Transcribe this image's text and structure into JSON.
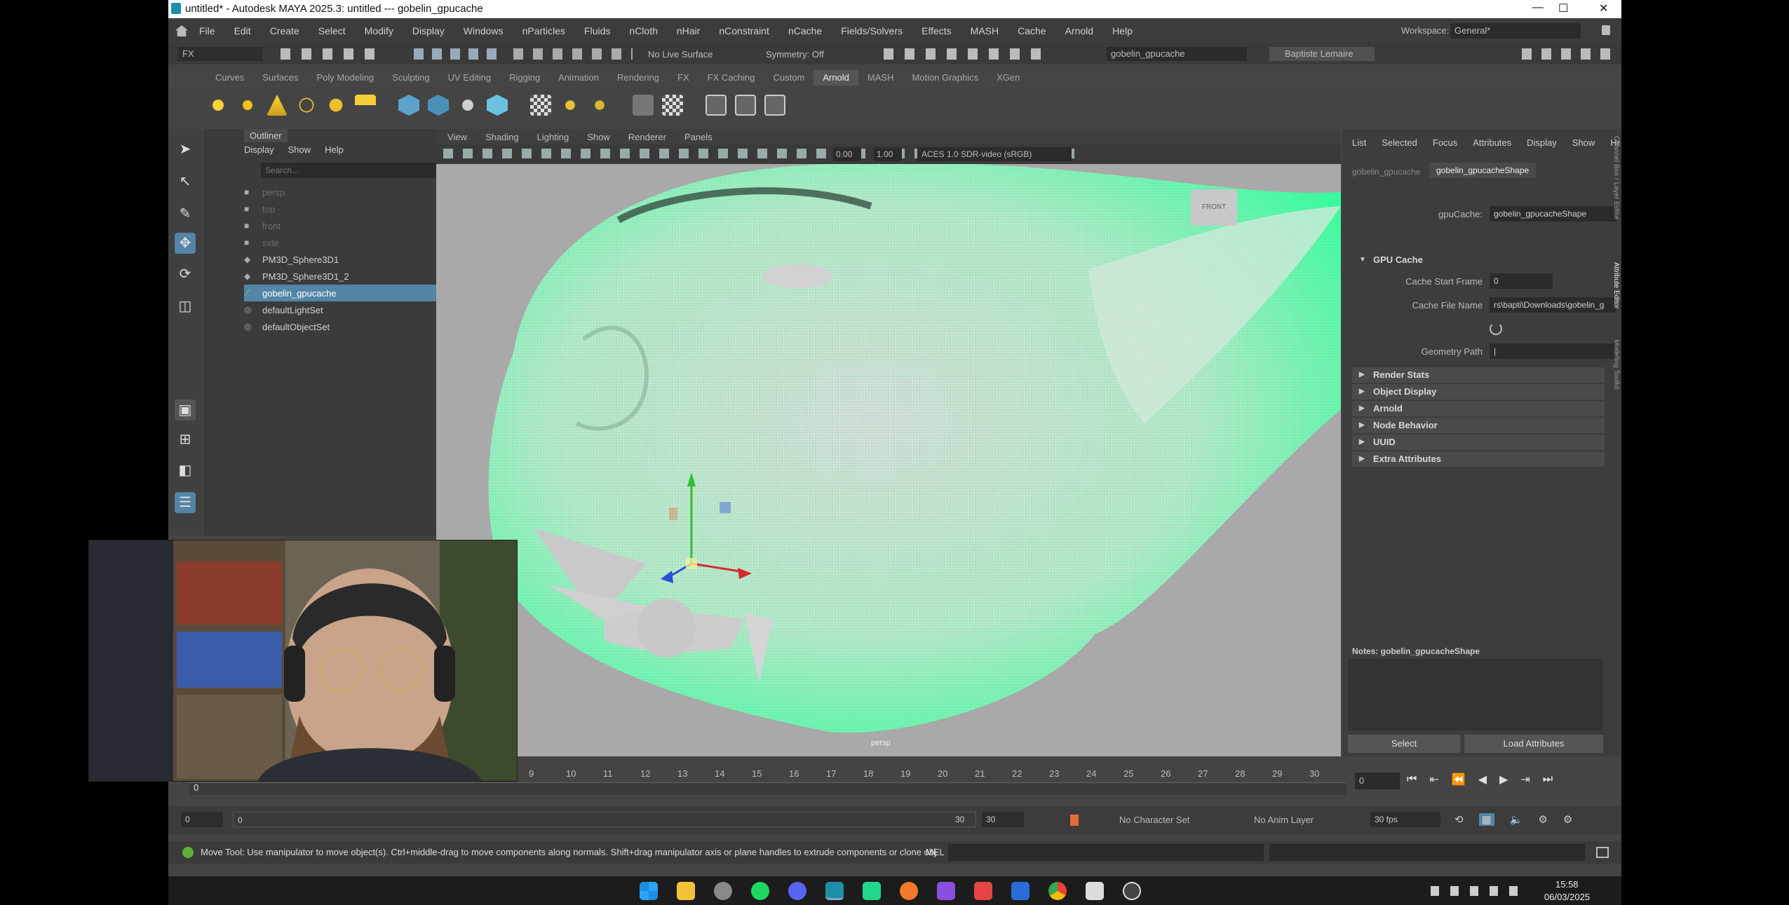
{
  "window": {
    "title": "untitled* - Autodesk MAYA 2025.3: untitled  ---  gobelin_gpucache",
    "controls": [
      "—",
      "☐",
      "✕"
    ]
  },
  "menubar": {
    "items": [
      "File",
      "Edit",
      "Create",
      "Select",
      "Modify",
      "Display",
      "Windows",
      "nParticles",
      "Fluids",
      "nCloth",
      "nHair",
      "nConstraint",
      "nCache",
      "Fields/Solvers",
      "Effects",
      "MASH",
      "Cache",
      "Arnold",
      "Help"
    ],
    "workspace_label": "Workspace:",
    "workspace_value": "General*"
  },
  "statusline": {
    "mode": "FX",
    "live_surface": "No Live Surface",
    "symmetry": "Symmetry: Off",
    "search_value": "gobelin_gpucache",
    "user": "Baptiste Lemaire"
  },
  "shelf": {
    "tabs": [
      "Curves",
      "Surfaces",
      "Poly Modeling",
      "Sculpting",
      "UV Editing",
      "Rigging",
      "Animation",
      "Rendering",
      "FX",
      "FX Caching",
      "Custom",
      "Arnold",
      "MASH",
      "Motion Graphics",
      "XGen"
    ],
    "active_tab": "Arnold"
  },
  "outliner": {
    "title": "Outliner",
    "menu": [
      "Display",
      "Show",
      "Help"
    ],
    "search_placeholder": "Search...",
    "items": [
      {
        "label": "persp",
        "icon": "camera-icon",
        "dim": true
      },
      {
        "label": "top",
        "icon": "camera-icon",
        "dim": true
      },
      {
        "label": "front",
        "icon": "camera-icon",
        "dim": true
      },
      {
        "label": "side",
        "icon": "camera-icon",
        "dim": true
      },
      {
        "label": "PM3D_Sphere3D1",
        "icon": "transform-icon",
        "dim": false
      },
      {
        "label": "PM3D_Sphere3D1_2",
        "icon": "transform-icon",
        "dim": false
      },
      {
        "label": "gobelin_gpucache",
        "icon": "gpucache-icon",
        "dim": false,
        "selected": true
      },
      {
        "label": "defaultLightSet",
        "icon": "set-icon",
        "dim": false
      },
      {
        "label": "defaultObjectSet",
        "icon": "set-icon",
        "dim": false
      }
    ]
  },
  "viewport": {
    "menu": [
      "View",
      "Shading",
      "Lighting",
      "Show",
      "Renderer",
      "Panels"
    ],
    "exposure": "0.00",
    "gamma": "1.00",
    "color_space": "ACES 1.0 SDR-video (sRGB)",
    "camera_label": "persp",
    "cube_label": "FRONT"
  },
  "attribute_editor": {
    "menu": [
      "List",
      "Selected",
      "Focus",
      "Attributes",
      "Display",
      "Show",
      "Help"
    ],
    "tabs": [
      "gobelin_gpucache",
      "gobelin_gpucacheShape"
    ],
    "node_label": "gpuCache:",
    "node_value": "gobelin_gpucacheShape",
    "gpu_section": "GPU Cache",
    "cache_start_label": "Cache Start Frame",
    "cache_start_value": "0",
    "cache_file_label": "Cache File Name",
    "cache_file_value": "rs\\bapti\\Downloads\\gobelin_g",
    "geometry_label": "Geometry Path",
    "geometry_value": "|",
    "sections": [
      "Render Stats",
      "Object Display",
      "Arnold",
      "Node Behavior",
      "UUID",
      "Extra Attributes"
    ],
    "notes_label": "Notes: gobelin_gpucacheShape",
    "select_btn": "Select",
    "load_btn": "Load Attributes",
    "side_tabs": [
      "Channel Box / Layer Editor",
      "Attribute Editor",
      "Modeling Toolkit"
    ]
  },
  "timeline": {
    "ticks": [
      "0",
      "9",
      "10",
      "11",
      "12",
      "13",
      "14",
      "15",
      "16",
      "17",
      "18",
      "19",
      "20",
      "21",
      "22",
      "23",
      "24",
      "25",
      "26",
      "27",
      "28",
      "29",
      "30"
    ],
    "current_frame": "0"
  },
  "range": {
    "start": "0",
    "inner_start": "0",
    "inner_end": "30",
    "end": "30",
    "char_set": "No Character Set",
    "anim_layer": "No Anim Layer",
    "fps": "30 fps"
  },
  "helpline": {
    "text": "Move Tool: Use manipulator to move object(s). Ctrl+middle-drag to move components along normals. Shift+drag manipulator axis or plane handles to extrude components or clone object",
    "mel_label": "MEL"
  },
  "taskbar": {
    "time": "15:58",
    "date": "06/03/2025"
  },
  "colors": {
    "accent": "#5285a6",
    "mesh_green": "#2dff9a",
    "app_bg": "#444444"
  }
}
